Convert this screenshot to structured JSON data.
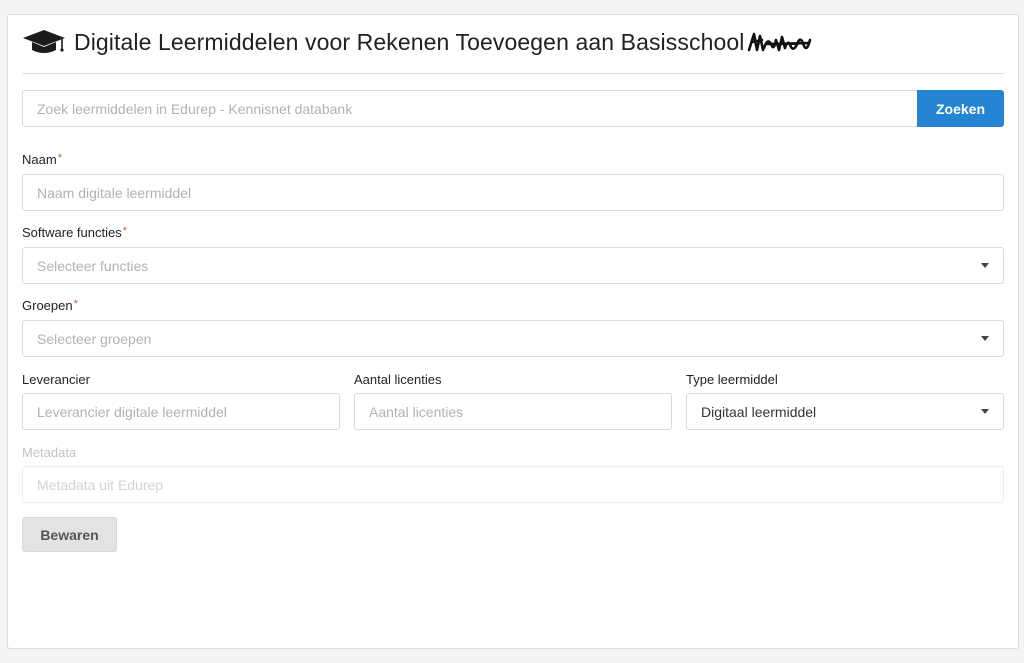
{
  "header": {
    "title": "Digitale Leermiddelen voor Rekenen Toevoegen aan Basisschool",
    "cap_icon": "graduation-cap-icon"
  },
  "search": {
    "placeholder": "Zoek leermiddelen in Edurep - Kennisnet databank",
    "button_label": "Zoeken"
  },
  "form": {
    "naam": {
      "label": "Naam",
      "required_mark": "*",
      "placeholder": "Naam digitale leermiddel"
    },
    "software_functies": {
      "label": "Software functies",
      "required_mark": "*",
      "placeholder": "Selecteer functies"
    },
    "groepen": {
      "label": "Groepen",
      "required_mark": "*",
      "placeholder": "Selecteer groepen"
    },
    "leverancier": {
      "label": "Leverancier",
      "placeholder": "Leverancier digitale leermiddel"
    },
    "aantal_licenties": {
      "label": "Aantal licenties",
      "placeholder": "Aantal licenties"
    },
    "type_leermiddel": {
      "label": "Type leermiddel",
      "value": "Digitaal leermiddel"
    },
    "metadata": {
      "label": "Metadata",
      "placeholder": "Metadata uit Edurep"
    },
    "save_label": "Bewaren"
  },
  "colors": {
    "accent": "#2584d3",
    "required": "#d9534f"
  }
}
